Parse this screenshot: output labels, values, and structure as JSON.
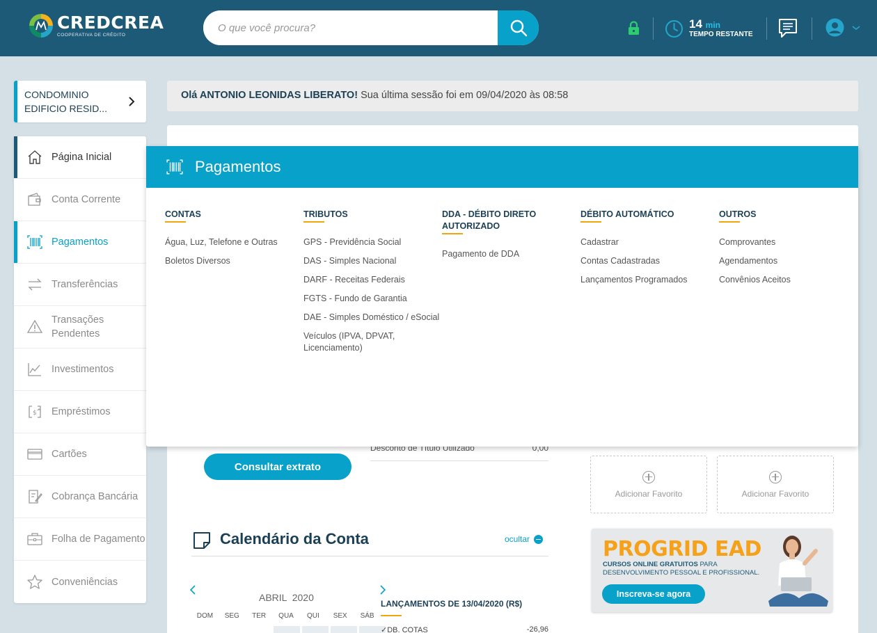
{
  "header": {
    "brand_name": "CREDCREA",
    "brand_sub": "COOPERATIVA DE CRÉDITO",
    "search_placeholder": "O que você procura?",
    "timer_value": "14",
    "timer_unit": "min",
    "timer_label": "TEMPO RESTANTE"
  },
  "account": {
    "name": "CONDOMINIO EDIFICIO RESID..."
  },
  "greeting": {
    "hello": "Olá ANTONIO LEONIDAS LIBERATO!",
    "session": " Sua última sessão foi em 09/04/2020 às 08:58"
  },
  "sidebar": {
    "items": [
      {
        "label": "Página Inicial",
        "icon": "home-icon"
      },
      {
        "label": "Conta Corrente",
        "icon": "wallet-icon"
      },
      {
        "label": "Pagamentos",
        "icon": "barcode-icon"
      },
      {
        "label": "Transferências",
        "icon": "transfer-icon"
      },
      {
        "label": "Transações Pendentes",
        "icon": "warning-icon"
      },
      {
        "label": "Investimentos",
        "icon": "chart-icon"
      },
      {
        "label": "Empréstimos",
        "icon": "loan-icon"
      },
      {
        "label": "Cartões",
        "icon": "card-icon"
      },
      {
        "label": "Cobrança Bancária",
        "icon": "billing-icon"
      },
      {
        "label": "Folha de Pagamento",
        "icon": "briefcase-icon"
      },
      {
        "label": "Conveniências",
        "icon": "star-icon"
      }
    ]
  },
  "mega": {
    "title": "Pagamentos",
    "columns": [
      {
        "title": "CONTAS",
        "links": [
          "Água, Luz, Telefone e Outras",
          "Boletos Diversos"
        ]
      },
      {
        "title": "TRIBUTOS",
        "links": [
          "GPS - Previdência Social",
          "DAS - Simples Nacional",
          "DARF - Receitas Federais",
          "FGTS - Fundo de Garantia",
          "DAE - Simples Doméstico / eSocial",
          "Veículos (IPVA, DPVAT, Licenciamento)"
        ]
      },
      {
        "title": "DDA - DÉBITO DIRETO AUTORIZADO",
        "links": [
          "Pagamento de DDA"
        ]
      },
      {
        "title": "DÉBITO AUTOMÁTICO",
        "links": [
          "Cadastrar",
          "Contas Cadastradas",
          "Lançamentos Programados"
        ]
      },
      {
        "title": "OUTROS",
        "links": [
          "Comprovantes",
          "Agendamentos",
          "Convênios Aceitos"
        ]
      }
    ]
  },
  "content": {
    "desc_label": "Desconto de Título Utilizado",
    "desc_value": "0,00",
    "extrato_button": "Consultar extrato",
    "fav_label": "Adicionar Favorito",
    "calendar_title": "Calendário da Conta",
    "calendar_hide": "ocultar",
    "calendar_month": "ABRIL  2020",
    "weekdays": [
      "DOM",
      "SEG",
      "TER",
      "QUA",
      "QUI",
      "SEX",
      "SÁB"
    ],
    "lanc_title": "LANÇAMENTOS DE 13/04/2020 (R$)",
    "lanc_item": "DB. COTAS",
    "lanc_value": "-26,96"
  },
  "banner": {
    "title": "PROGRID EAD",
    "sub_bold": "CURSOS ONLINE GRATUITOS",
    "sub_rest": " PARA DESENVOLVIMENTO PESSOAL E PROFISSIONAL.",
    "button": "Inscreva-se agora"
  },
  "colors": {
    "header": "#1d5a78",
    "accent": "#08a1c9",
    "underline": "#f0a50a",
    "lock": "#2ecc71"
  }
}
